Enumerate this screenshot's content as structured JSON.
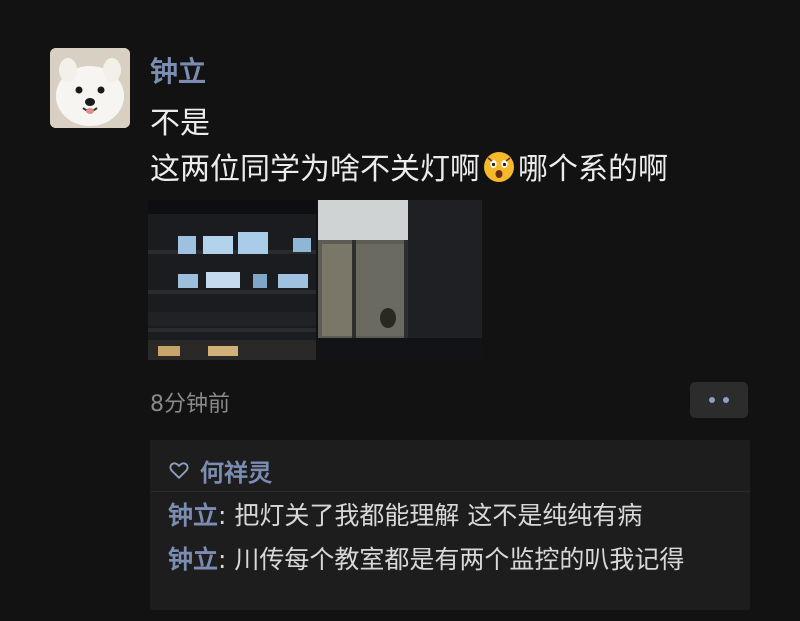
{
  "post": {
    "author": "钟立",
    "line1": "不是",
    "line2_before": "这两位同学为啥不关灯啊",
    "line2_emoji": "shocked-face-emoji",
    "line2_after": "哪个系的啊",
    "timestamp": "8分钟前"
  },
  "photos": [
    {
      "icon": "night-building-photo"
    },
    {
      "icon": "lit-window-photo"
    }
  ],
  "likes": {
    "icon": "heart-icon",
    "names": "何祥灵"
  },
  "comments": [
    {
      "name": "钟立",
      "sep": ": ",
      "text": "把灯关了我都能理解 这不是纯纯有病"
    },
    {
      "name": "钟立",
      "sep": ": ",
      "text": "川传每个教室都是有两个监控的叭我记得"
    }
  ],
  "colors": {
    "background": "#121212",
    "name_blue": "#7b8db3",
    "panel": "#1d1d1d"
  }
}
